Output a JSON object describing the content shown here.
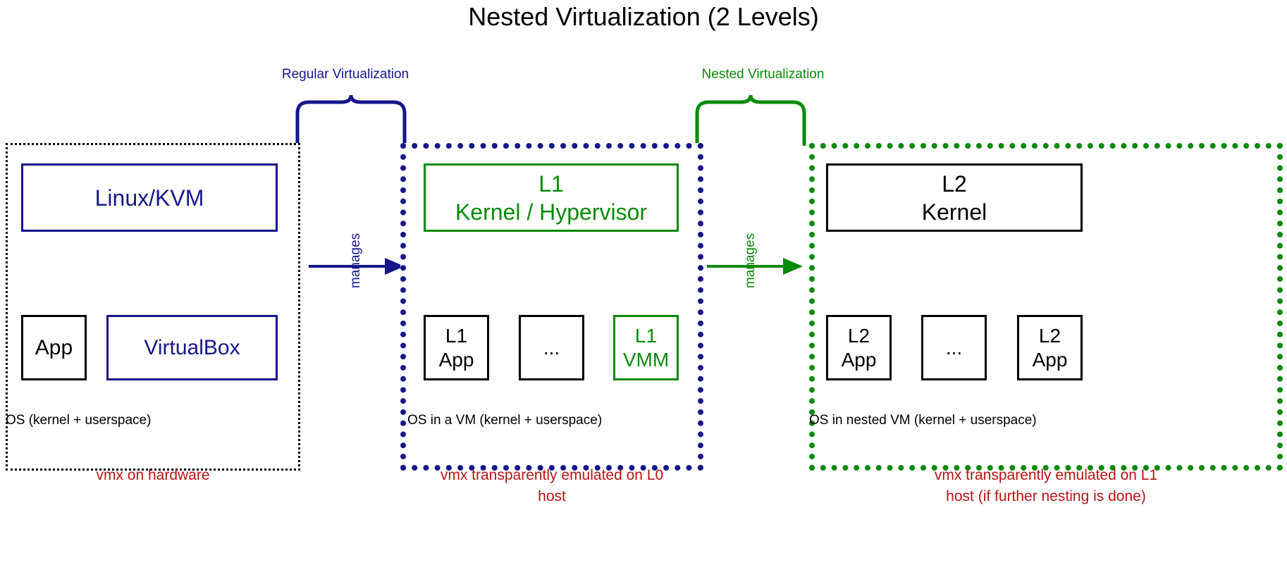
{
  "title": "Nested Virtualization (2 Levels)",
  "colors": {
    "navy": "#16168c",
    "green": "#0a8a0a",
    "black": "#000000",
    "red": "#b81414"
  },
  "brackets": [
    {
      "label": "Regular Virtualization",
      "color": "#16168c"
    },
    {
      "label": "Nested Virtualization",
      "color": "#0a8a0a"
    }
  ],
  "arrows": [
    {
      "label": "manages",
      "color": "#16168c"
    },
    {
      "label": "manages",
      "color": "#0a8a0a"
    }
  ],
  "panels": [
    {
      "id": "l0",
      "border_style": "dotted-black",
      "caption": "OS (kernel + userspace)",
      "note": "vmx on hardware",
      "boxes": [
        {
          "id": "linux-kvm",
          "style": "navy",
          "lines": [
            "Linux/KVM"
          ]
        },
        {
          "id": "app",
          "style": "black",
          "lines": [
            "App"
          ]
        },
        {
          "id": "virtualbox",
          "style": "navy",
          "lines": [
            "VirtualBox"
          ]
        }
      ]
    },
    {
      "id": "l1",
      "border_style": "dotted-navy",
      "caption": "OS in a VM (kernel + userspace)",
      "note": "vmx transparently emulated on L0 host",
      "boxes": [
        {
          "id": "l1-kernel",
          "style": "green",
          "lines": [
            "L1",
            "Kernel / Hypervisor"
          ]
        },
        {
          "id": "l1-app",
          "style": "black",
          "lines": [
            "L1",
            "App"
          ]
        },
        {
          "id": "l1-ellipsis",
          "style": "black",
          "lines": [
            "..."
          ]
        },
        {
          "id": "l1-vmm",
          "style": "green",
          "lines": [
            "L1",
            "VMM"
          ]
        }
      ]
    },
    {
      "id": "l2",
      "border_style": "dotted-green",
      "caption": "OS in nested VM (kernel + userspace)",
      "note": "vmx transparently emulated on L1 host (if further nesting is done)",
      "boxes": [
        {
          "id": "l2-kernel",
          "style": "black",
          "lines": [
            "L2",
            "Kernel"
          ]
        },
        {
          "id": "l2-app-left",
          "style": "black",
          "lines": [
            "L2",
            "App"
          ]
        },
        {
          "id": "l2-ellipsis",
          "style": "black",
          "lines": [
            "..."
          ]
        },
        {
          "id": "l2-app-right",
          "style": "black",
          "lines": [
            "L2",
            "App"
          ]
        }
      ]
    }
  ],
  "notes": {
    "left": "vmx on hardware",
    "middle_line1": "vmx transparently emulated on L0",
    "middle_line2": "host",
    "right_line1": "vmx transparently emulated on L1",
    "right_line2": "host (if further nesting is done)"
  }
}
